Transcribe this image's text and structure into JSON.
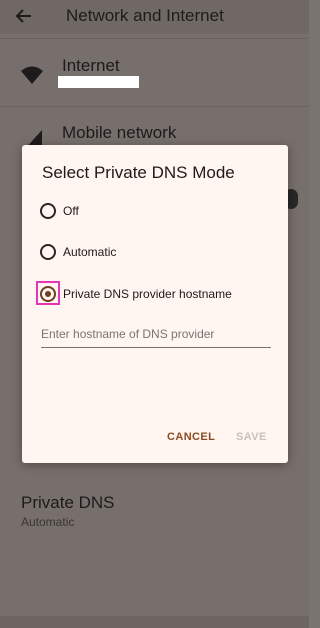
{
  "header": {
    "title": "Network and Internet"
  },
  "rows": {
    "internet": {
      "title": "Internet"
    },
    "mobile": {
      "title": "Mobile network"
    },
    "private_dns": {
      "title": "Private DNS",
      "subtitle": "Automatic"
    }
  },
  "dialog": {
    "title": "Select Private DNS Mode",
    "options": [
      {
        "label": "Off",
        "checked": false
      },
      {
        "label": "Automatic",
        "checked": false
      },
      {
        "label": "Private DNS provider hostname",
        "checked": true
      }
    ],
    "hostname": {
      "value": "",
      "placeholder": "Enter hostname of DNS provider"
    },
    "cancel_label": "CANCEL",
    "save_label": "SAVE"
  },
  "icons": {
    "back": "arrow-back-icon",
    "internet": "wifi-icon",
    "mobile": "signal-icon"
  },
  "colors": {
    "accent": "#8b4b22",
    "radio_checked": "#6c3f23",
    "highlight": "#e235b8",
    "dialog_bg": "#fff5f1"
  }
}
